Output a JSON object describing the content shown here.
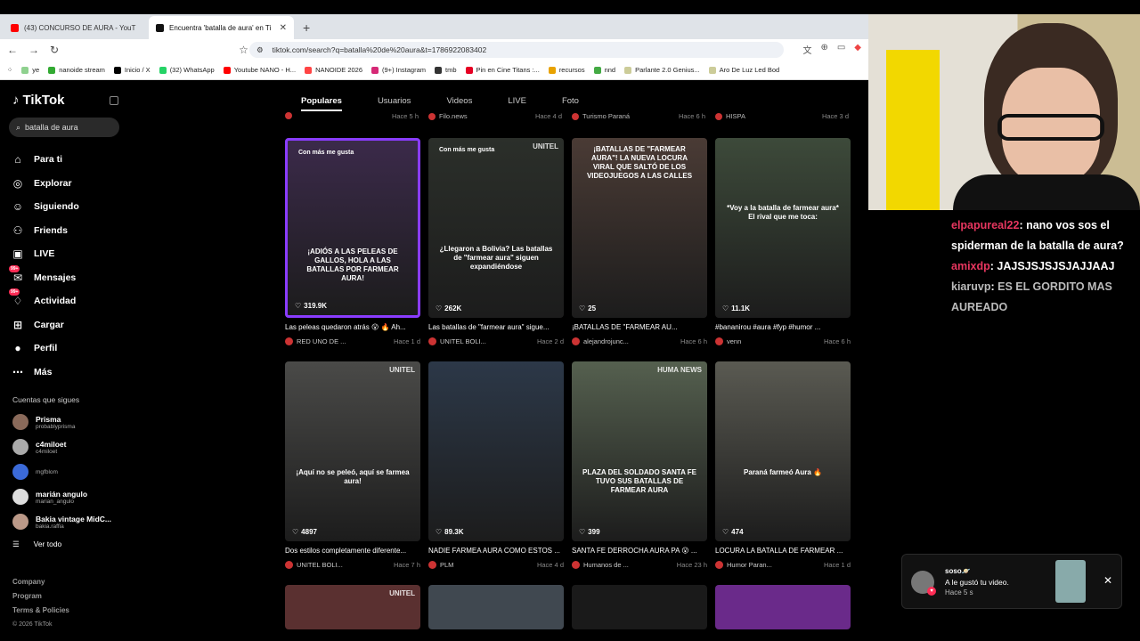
{
  "browser": {
    "tabs": [
      {
        "label": "(43) CONCURSO DE AURA - YouT",
        "color": "#ff0000"
      },
      {
        "label": "Encuentra 'batalla de aura' en Ti",
        "color": "#111111"
      }
    ],
    "url": "tiktok.com/search?q=batalla%20de%20aura&t=1786922083402",
    "bookmarks": [
      {
        "label": "ye",
        "color": "#8fd18f"
      },
      {
        "label": "nanoide stream",
        "color": "#3a3"
      },
      {
        "label": "Inicio / X",
        "color": "#000"
      },
      {
        "label": "(32) WhatsApp",
        "color": "#25d366"
      },
      {
        "label": "Youtube NANO - H...",
        "color": "#f00"
      },
      {
        "label": "NANOIDE 2026",
        "color": "#f44"
      },
      {
        "label": "(9+) Instagram",
        "color": "#d62976"
      },
      {
        "label": "tmb",
        "color": "#333"
      },
      {
        "label": "Pin en Cine Titans :...",
        "color": "#e60023"
      },
      {
        "label": "recursos",
        "color": "#e8a200"
      },
      {
        "label": "nnd",
        "color": "#4a4"
      },
      {
        "label": "Parlante 2.0 Genius...",
        "color": "#cc9"
      },
      {
        "label": "Aro De Luz Led Bod",
        "color": "#cc9"
      }
    ]
  },
  "tiktok": {
    "logo": "TikTok",
    "search_value": "batalla de aura",
    "nav": [
      {
        "label": "Para ti",
        "icon": "home-icon",
        "glyph": "⌂"
      },
      {
        "label": "Explorar",
        "icon": "compass-icon",
        "glyph": "◎"
      },
      {
        "label": "Siguiendo",
        "icon": "following-icon",
        "glyph": "☺"
      },
      {
        "label": "Friends",
        "icon": "friends-icon",
        "glyph": "⚇"
      },
      {
        "label": "LIVE",
        "icon": "live-icon",
        "glyph": "▣"
      },
      {
        "label": "Mensajes",
        "icon": "messages-icon",
        "glyph": "✉",
        "badge": "99+"
      },
      {
        "label": "Actividad",
        "icon": "activity-icon",
        "glyph": "♢",
        "badge": "99+"
      },
      {
        "label": "Cargar",
        "icon": "upload-icon",
        "glyph": "⊞"
      },
      {
        "label": "Perfil",
        "icon": "profile-icon",
        "glyph": "●"
      },
      {
        "label": "Más",
        "icon": "more-icon",
        "glyph": "⋯"
      }
    ],
    "following_header": "Cuentas que sigues",
    "following": [
      {
        "name": "Prisma",
        "handle": "probablyprisma"
      },
      {
        "name": "c4miloet",
        "handle": "c4miloet"
      },
      {
        "name": "",
        "handle": "mgfblom"
      },
      {
        "name": "marián angulo",
        "handle": "marian_angulo"
      },
      {
        "name": "Bakia vintage MidC...",
        "handle": "bakia.raffia"
      }
    ],
    "see_all": "Ver todo",
    "footer": [
      "Company",
      "Program",
      "Terms & Policies"
    ],
    "copyright": "© 2026 TikTok",
    "page_tabs": [
      "Populares",
      "Usuarios",
      "Videos",
      "LIVE",
      "Foto"
    ],
    "top_row": [
      {
        "author": "",
        "ago": "Hace 5 h"
      },
      {
        "author": "Filo.news",
        "ago": "Hace 4 d"
      },
      {
        "author": "Turismo Paraná",
        "ago": "Hace 6 h"
      },
      {
        "author": "HISPA",
        "ago": "Hace 3 d"
      }
    ],
    "videos": [
      {
        "tag": "Con más me gusta",
        "wm": "",
        "overlay": "¡ADIÓS A LAS PELEAS DE GALLOS, HOLA A LAS BATALLAS POR FARMEAR AURA!",
        "likes": "319.9K",
        "title": "Las peleas quedaron atrás 😮 🔥 Ah...",
        "author": "RED UNO DE ...",
        "ago": "Hace 1 d",
        "bg": "#3b2a4a"
      },
      {
        "tag": "Con más me gusta",
        "wm": "UNITEL",
        "overlay": "¿Llegaron a Bolivia? Las batallas de \"farmear aura\" siguen expandiéndose",
        "likes": "262K",
        "title": "Las batallas de \"farmear aura\" sigue...",
        "author": "UNITEL BOLI...",
        "ago": "Hace 2 d",
        "bg": "#2b2f2a"
      },
      {
        "tag": "",
        "wm": "",
        "overlay": "¡BATALLAS DE \"FARMEAR AURA\"! LA NUEVA LOCURA VIRAL QUE SALTÓ DE LOS VIDEOJUEGOS A LAS CALLES",
        "likes": "25",
        "title": "¡BATALLAS DE \"FARMEAR AU...",
        "author": "alejandrojunc...",
        "ago": "Hace 6 h",
        "bg": "#4a3b35"
      },
      {
        "tag": "",
        "wm": "",
        "overlay": "*Voy a la batalla de farmear aura* El rival que me toca:",
        "likes": "11.1K",
        "title": "#bananirou #aura #fyp #humor ...",
        "author": "venn",
        "ago": "Hace 6 h",
        "bg": "#3d4a3a"
      },
      {
        "tag": "",
        "wm": "UNITEL",
        "overlay": "¡Aquí no se peleó, aquí se farmea aura!",
        "likes": "4897",
        "title": "Dos estilos completamente diferente...",
        "author": "UNITEL BOLI...",
        "ago": "Hace 7 h",
        "bg": "#4a4a48"
      },
      {
        "tag": "",
        "wm": "",
        "overlay": "",
        "likes": "89.3K",
        "title": "NADIE FARMEA AURA COMO ESTOS ...",
        "author": "PLM",
        "ago": "Hace 4 d",
        "bg": "#2c3848"
      },
      {
        "tag": "",
        "wm": "HUMA NEWS",
        "overlay": "PLAZA DEL SOLDADO SANTA FE TUVO SUS BATALLAS DE FARMEAR AURA",
        "likes": "399",
        "title": "SANTA FE DERROCHA AURA PA 😮 ...",
        "author": "Humanos de ...",
        "ago": "Hace 23 h",
        "bg": "#55604f"
      },
      {
        "tag": "",
        "wm": "",
        "overlay": "Paraná farmeó Aura 🔥",
        "likes": "474",
        "title": "LOCURA LA BATALLA DE FARMEAR ...",
        "author": "Humor Paran...",
        "ago": "Hace 1 d",
        "bg": "#5a5a52"
      }
    ],
    "bottom_row": [
      {
        "wm": "UNITEL",
        "bg": "#5a3030"
      },
      {
        "wm": "",
        "bg": "#404850"
      },
      {
        "wm": "",
        "bg": "#1a1a1a"
      },
      {
        "wm": "",
        "bg": "#6a2a8a"
      }
    ]
  },
  "chat": [
    {
      "user": "elpapureal22",
      "message": "nano vos sos el spiderman de la batalla de aura?"
    },
    {
      "user": "amixdp",
      "message": "JAJSJSJSJSJAJJAAJ"
    },
    {
      "user": "kiaruvp",
      "message": "ES EL GORDITO MAS AUREADO"
    }
  ],
  "notification": {
    "user": "soso🪐",
    "text": "A le gustó tu video.",
    "ago": "Hace 5 s"
  }
}
